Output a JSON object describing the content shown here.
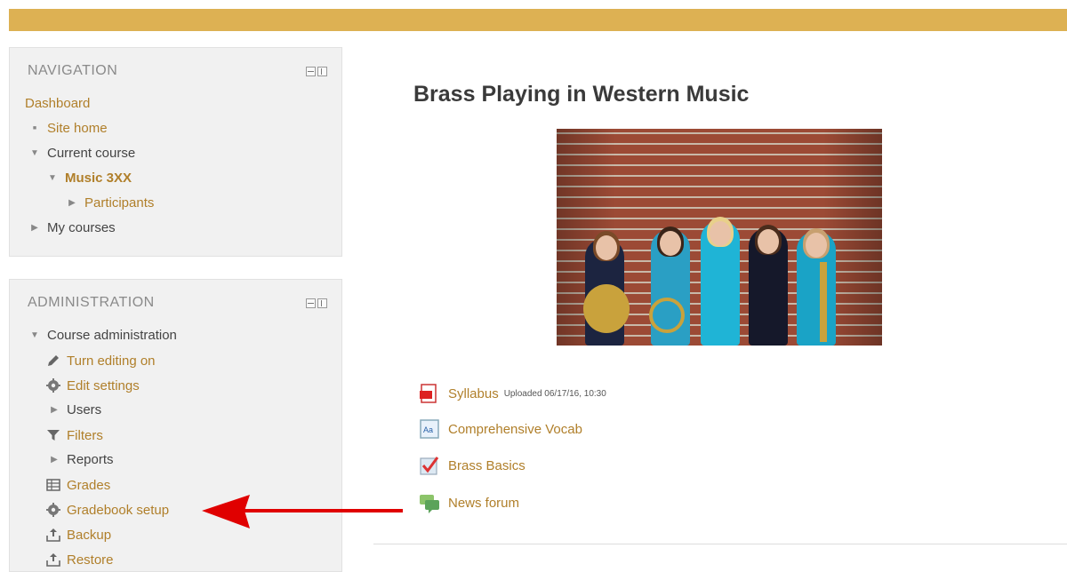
{
  "colors": {
    "topbar": "#ddb153",
    "link": "#b07f2a",
    "arrow": "#e00000"
  },
  "navigation": {
    "title": "NAVIGATION",
    "dashboard": "Dashboard",
    "site_home": "Site home",
    "current_course": "Current course",
    "course_name": "Music 3XX",
    "participants": "Participants",
    "my_courses": "My courses"
  },
  "administration": {
    "title": "ADMINISTRATION",
    "course_admin": "Course administration",
    "items": [
      {
        "label": "Turn editing on",
        "icon": "pencil-icon"
      },
      {
        "label": "Edit settings",
        "icon": "gear-icon"
      },
      {
        "label": "Users",
        "icon": "expand-arrow-icon"
      },
      {
        "label": "Filters",
        "icon": "filter-icon"
      },
      {
        "label": "Reports",
        "icon": "expand-arrow-icon"
      },
      {
        "label": "Grades",
        "icon": "grades-table-icon"
      },
      {
        "label": "Gradebook setup",
        "icon": "gear-icon"
      },
      {
        "label": "Backup",
        "icon": "upload-icon"
      },
      {
        "label": "Restore",
        "icon": "restore-icon"
      }
    ]
  },
  "course": {
    "title": "Brass Playing in Western Music",
    "activities": [
      {
        "name": "Syllabus",
        "note": "Uploaded 06/17/16, 10:30",
        "icon": "pdf-icon"
      },
      {
        "name": "Comprehensive Vocab",
        "icon": "glossary-icon"
      },
      {
        "name": "Brass Basics",
        "icon": "quiz-icon"
      },
      {
        "name": "News forum",
        "icon": "forum-icon"
      }
    ]
  }
}
